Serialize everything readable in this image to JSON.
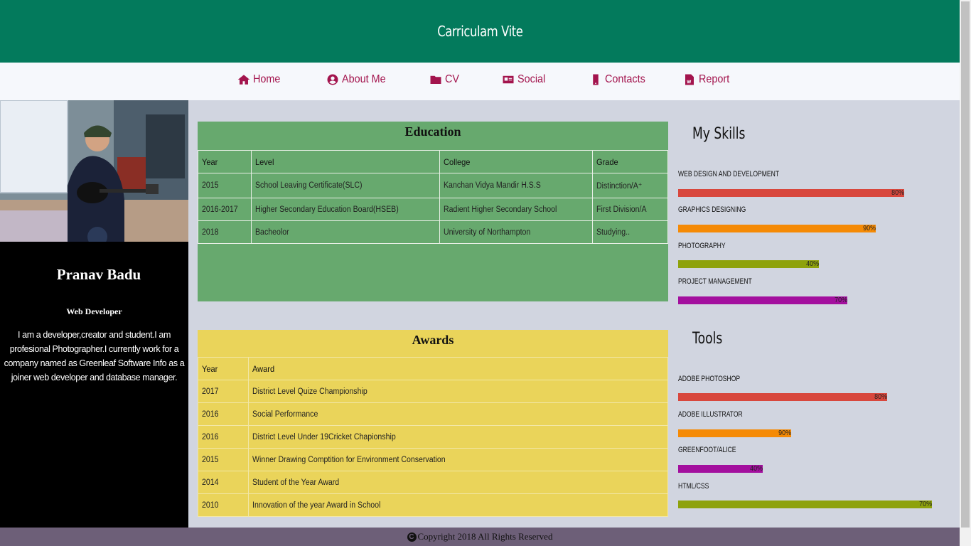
{
  "header": {
    "title": "Carriculam Vite"
  },
  "nav": {
    "items": [
      {
        "label": "Home",
        "icon": "home-icon"
      },
      {
        "label": "About Me",
        "icon": "user-circle-icon"
      },
      {
        "label": "CV",
        "icon": "folder-icon"
      },
      {
        "label": "Social",
        "icon": "id-card-icon"
      },
      {
        "label": "Contacts",
        "icon": "mobile-phone-icon"
      },
      {
        "label": "Report",
        "icon": "word-document-icon"
      }
    ]
  },
  "profile": {
    "name": "Pranav Badu",
    "role": "Web Developer",
    "bio": "I am a developer,creator and student.I am profesional Photographer.I currently work for a company named as Greenleaf Software Info as a joiner web developer and database manager."
  },
  "education": {
    "title": "Education",
    "headers": [
      "Year",
      "Level",
      "College",
      "Grade"
    ],
    "rows": [
      [
        "2015",
        "School Leaving Certificate(SLC)",
        "Kanchan Vidya Mandir H.S.S",
        "Distinction/A⁺"
      ],
      [
        "2016-2017",
        "Higher Secondary Education Board(HSEB)",
        "Radient Higher Secondary School",
        "First Division/A"
      ],
      [
        "2018",
        "Bacheolor",
        "University of Northampton",
        "Studying.."
      ]
    ]
  },
  "awards": {
    "title": "Awards",
    "headers": [
      "Year",
      "Award"
    ],
    "rows": [
      [
        "2017",
        "District Level Quize Championship"
      ],
      [
        "2016",
        "Social Performance"
      ],
      [
        "2016",
        "District Level Under 19Cricket Chapionship"
      ],
      [
        "2015",
        "Winner Drawing Comptition for Environment Conservation"
      ],
      [
        "2014",
        "Student of the Year Award"
      ],
      [
        "2010",
        "Innovation of the year Award in School"
      ]
    ]
  },
  "skills": {
    "title": "My Skills",
    "items": [
      {
        "label": "WEB DESIGN AND DEVELOPMENT",
        "value": "80%",
        "fraction": 0.8,
        "color": "#d8473d"
      },
      {
        "label": "GRAPHICS DESIGNING",
        "value": "90%",
        "fraction": 0.7,
        "color": "#f58a05"
      },
      {
        "label": "PHOTOGRAPHY",
        "value": "40%",
        "fraction": 0.52,
        "color": "#8ea20c"
      },
      {
        "label": "PROJECT MANAGEMENT",
        "value": "70%",
        "fraction": 0.63,
        "color": "#a30f9e"
      }
    ]
  },
  "tools": {
    "title": "Tools",
    "items": [
      {
        "label": "ADOBE PHOTOSHOP",
        "value": "80%",
        "fraction": 0.74,
        "color": "#d8473d"
      },
      {
        "label": "ADOBE ILLUSTRATOR",
        "value": "90%",
        "fraction": 0.42,
        "color": "#f58a05"
      },
      {
        "label": "GREENFOOT/ALICE",
        "value": "40%",
        "fraction": 0.31,
        "color": "#a30f9e"
      },
      {
        "label": "HTML/CSS",
        "value": "70%",
        "fraction": 0.94,
        "color": "#8ea20c"
      }
    ]
  },
  "footer": {
    "text": "Copyright 2018 All Rights Reserved"
  }
}
